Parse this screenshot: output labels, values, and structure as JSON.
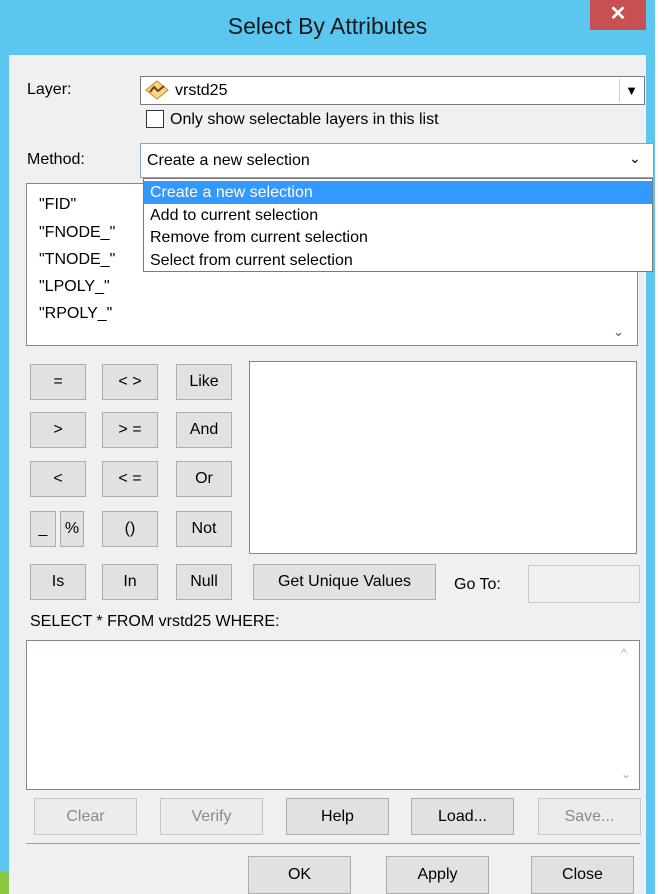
{
  "window": {
    "title": "Select By Attributes",
    "close_glyph": "✕"
  },
  "layer": {
    "label": "Layer:",
    "value": "vrstd25",
    "dropdown_glyph": "▼",
    "icon": "line-layer-icon"
  },
  "only_selectable": {
    "label": "Only show selectable layers in this list",
    "checked": false
  },
  "method": {
    "label": "Method:",
    "value": "Create a new selection",
    "dropdown_glyph": "⌄",
    "options": [
      "Create a new selection",
      "Add to current selection",
      "Remove from current selection",
      "Select from current selection"
    ],
    "highlighted_index": 0
  },
  "fields": [
    "\"FID\"",
    "\"FNODE_\"",
    "\"TNODE_\"",
    "\"LPOLY_\"",
    "\"RPOLY_\""
  ],
  "fields_scroll_glyph": "⌄",
  "operators": {
    "eq": "=",
    "ne": "< >",
    "like": "Like",
    "gt": ">",
    "ge": "> =",
    "and": "And",
    "lt": "<",
    "le": "< =",
    "or": "Or",
    "underscore": "_",
    "percent": "%",
    "parens": "()",
    "not": "Not",
    "is": "Is",
    "in": "In",
    "null": "Null"
  },
  "unique": {
    "get_values": "Get Unique Values",
    "goto_label": "Go To:",
    "goto_value": ""
  },
  "sql": {
    "prefix": "SELECT * FROM vrstd25 WHERE:",
    "expression": "",
    "scroll_up": "^",
    "scroll_down": "⌄"
  },
  "buttons": {
    "clear": "Clear",
    "verify": "Verify",
    "help": "Help",
    "load": "Load...",
    "save": "Save...",
    "ok": "OK",
    "apply": "Apply",
    "close": "Close"
  },
  "colors": {
    "title_bar": "#5bc6f0",
    "close_button": "#c75050",
    "selection": "#3399ff",
    "corner_accent": "#8dc63f"
  }
}
